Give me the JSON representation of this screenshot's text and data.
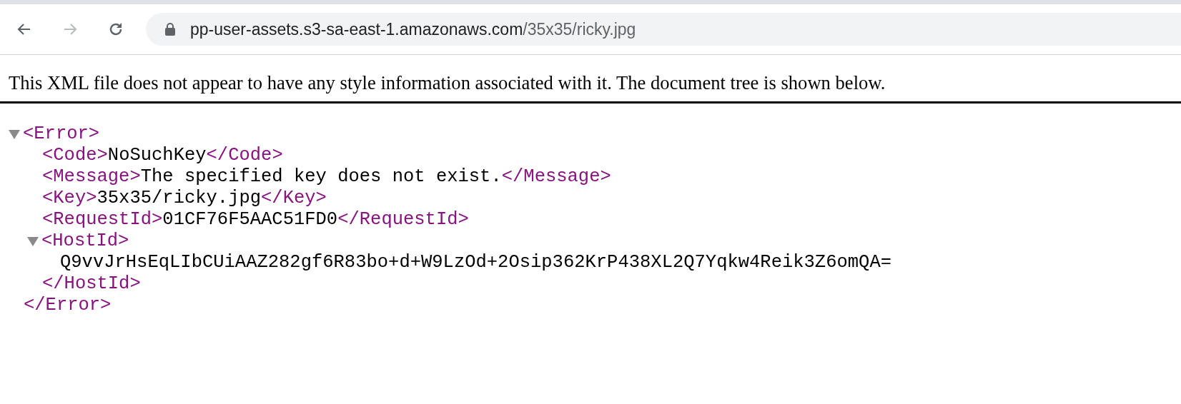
{
  "toolbar": {
    "back": {
      "disabled": false
    },
    "forward": {
      "disabled": true
    }
  },
  "address_bar": {
    "host": "pp-user-assets.s3-sa-east-1.amazonaws.com",
    "path": "/35x35/ricky.jpg"
  },
  "notice": "This XML file does not appear to have any style information associated with it. The document tree is shown below.",
  "tree": {
    "open": "<Error>",
    "close": "</Error>",
    "expanded": true,
    "children": [
      {
        "open": "<Code>",
        "text": "NoSuchKey",
        "close": "</Code>"
      },
      {
        "open": "<Message>",
        "text": "The specified key does not exist.",
        "close": "</Message>"
      },
      {
        "open": "<Key>",
        "text": "35x35/ricky.jpg",
        "close": "</Key>"
      },
      {
        "open": "<RequestId>",
        "text": "01CF76F5AAC51FD0",
        "close": "</RequestId>"
      },
      {
        "open": "<HostId>",
        "close": "</HostId>",
        "expanded": true,
        "children": [
          {
            "text": "Q9vvJrHsEqLIbCUiAAZ282gf6R83bo+d+W9LzOd+2Osip362KrP438XL2Q7Yqkw4Reik3Z6omQA="
          }
        ]
      }
    ]
  }
}
